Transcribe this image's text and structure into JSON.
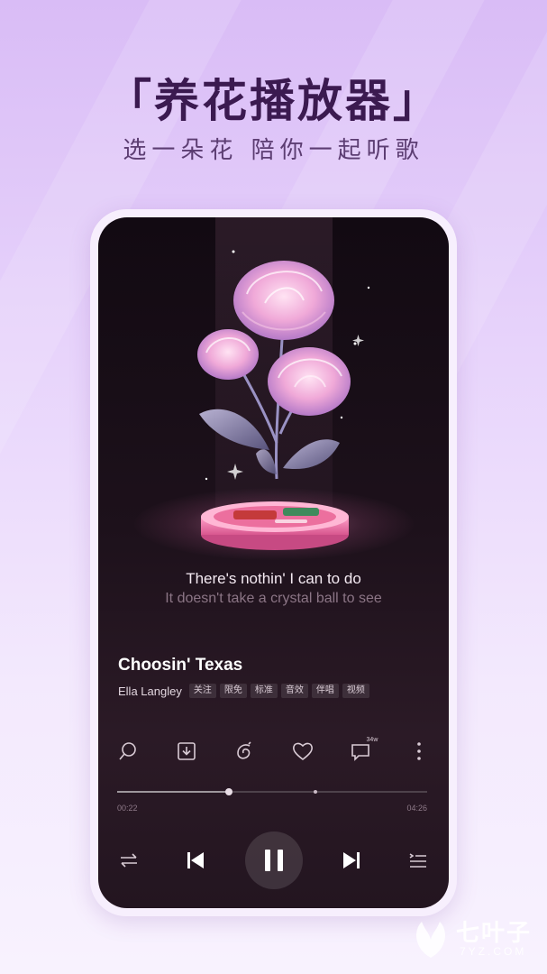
{
  "headline": "「养花播放器」",
  "subheadline": "选一朵花 陪你一起听歌",
  "player": {
    "lyric_current": "There's nothin' I can to do",
    "lyric_next": "It doesn't take a crystal ball to see",
    "song_title": "Choosin' Texas",
    "artist": "Ella Langley",
    "tags": [
      "关注",
      "限免",
      "标准",
      "音效",
      "伴唱",
      "视频"
    ],
    "comment_count": "34w",
    "elapsed": "00:22",
    "duration": "04:26",
    "progress_fraction": 0.36,
    "buffer_fraction": 0.64
  },
  "icons": {
    "actions": [
      "search-lyrics-icon",
      "download-icon",
      "flower-icon",
      "heart-icon",
      "comment-icon",
      "more-icon"
    ],
    "controls": [
      "shuffle-icon",
      "previous-icon",
      "pause-icon",
      "next-icon",
      "playlist-icon"
    ]
  },
  "watermark": {
    "brand": "七叶子",
    "domain": "7YZ.COM"
  },
  "colors": {
    "background_top": "#d9bcf6",
    "headline": "#3b1a50",
    "screen_bg": "#1d111b",
    "accent_pink": "#f4a6cf"
  }
}
